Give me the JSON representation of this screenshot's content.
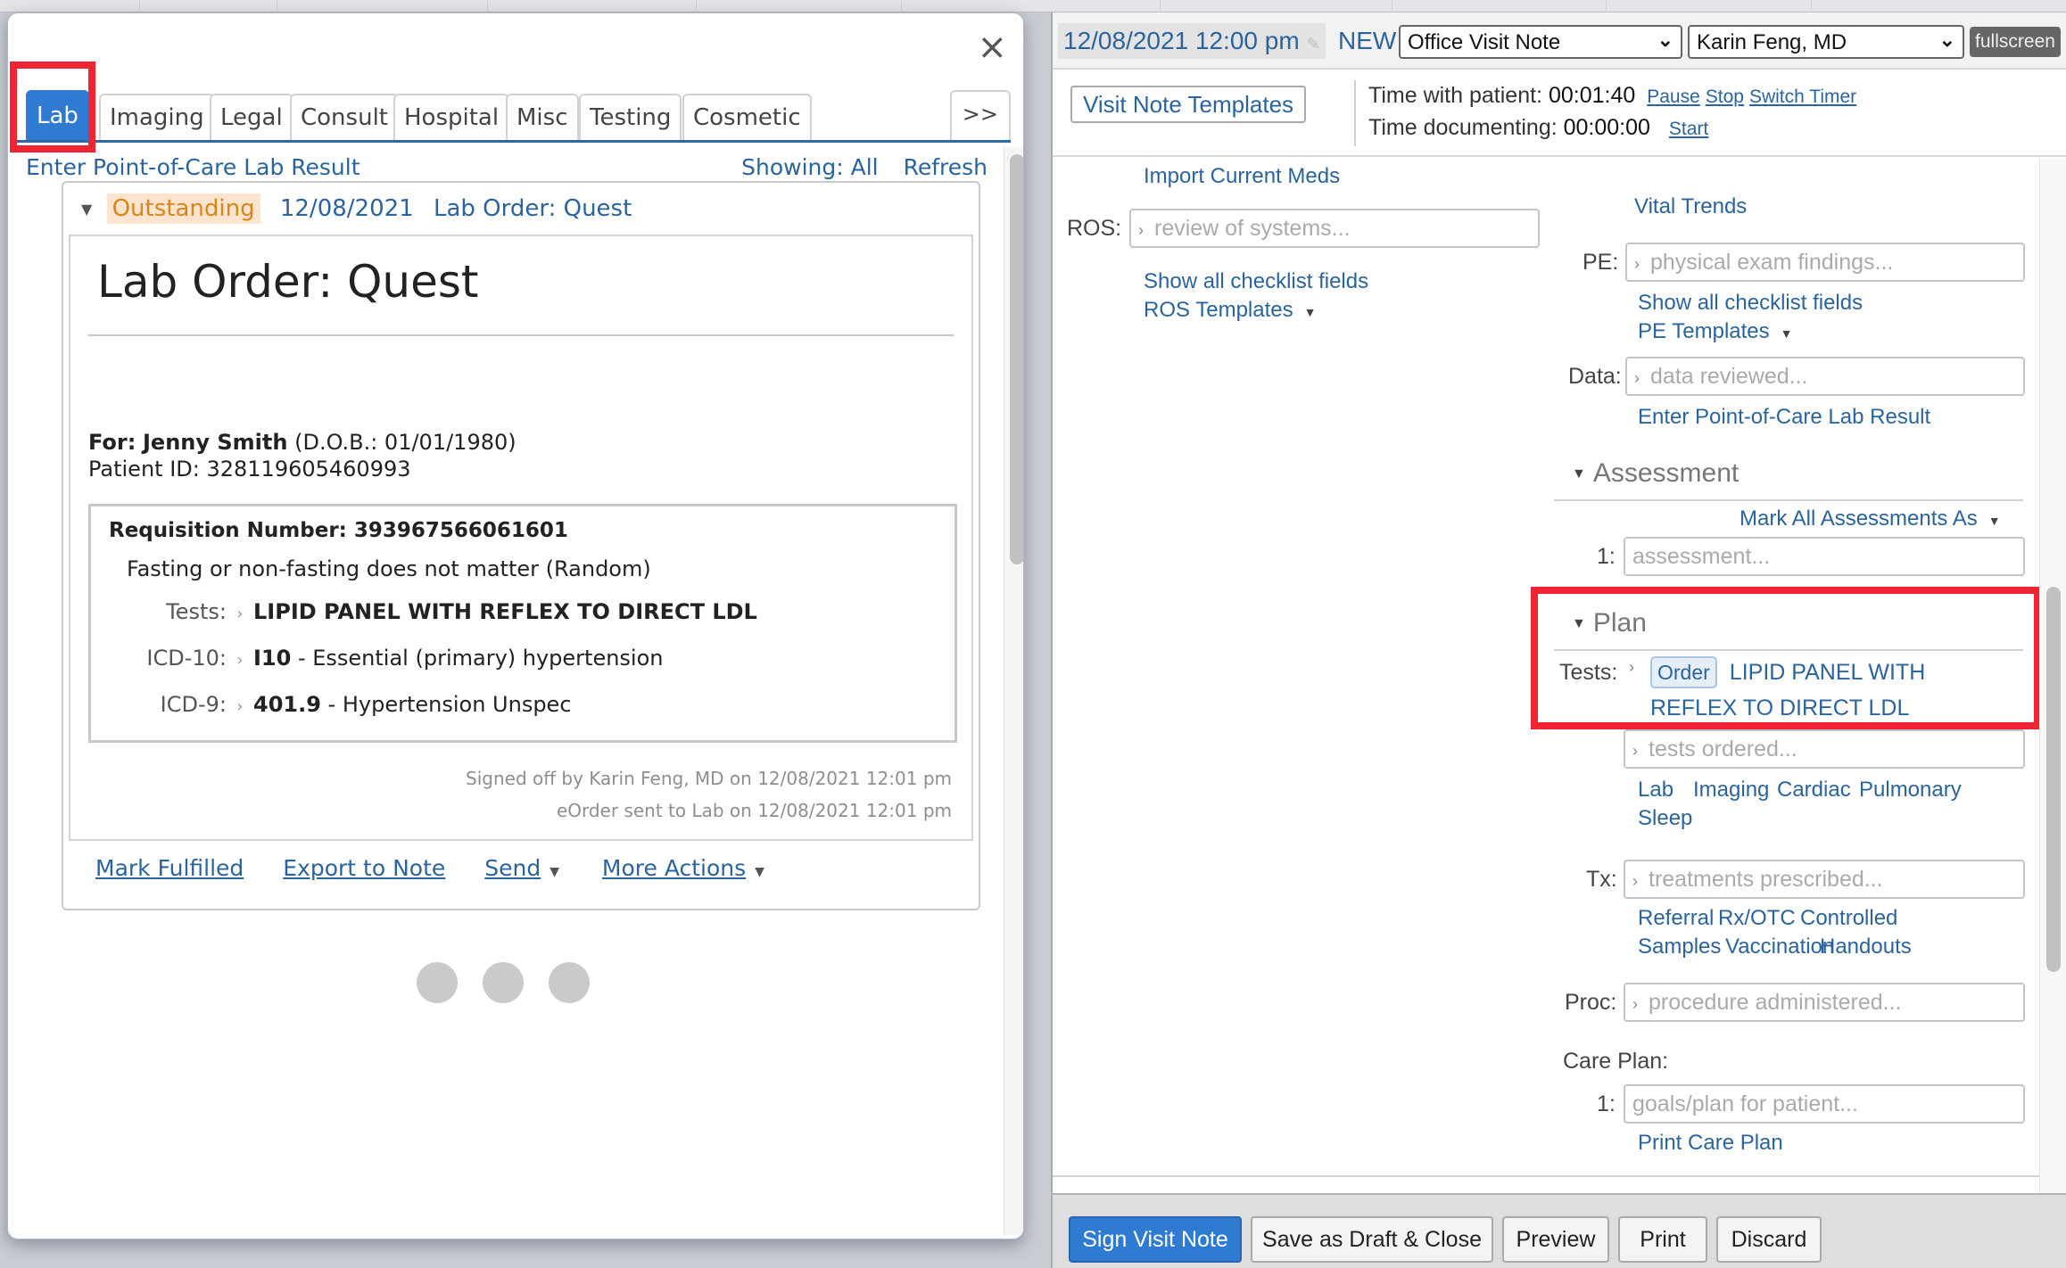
{
  "dialog": {
    "close_label": "×",
    "tabs": [
      {
        "label": "Lab",
        "active": true
      },
      {
        "label": "Imaging"
      },
      {
        "label": "Legal"
      },
      {
        "label": "Consult"
      },
      {
        "label": "Hospital"
      },
      {
        "label": "Misc"
      },
      {
        "label": "Testing"
      },
      {
        "label": "Cosmetic"
      }
    ],
    "tabs_more_label": ">>",
    "enter_poc_link": "Enter Point-of-Care Lab Result",
    "showing_label": "Showing: All",
    "refresh_label": "Refresh",
    "card": {
      "status": "Outstanding",
      "date": "12/08/2021",
      "title": "Lab Order: Quest",
      "doc_title": "Lab Order: Quest",
      "for_label": "For:",
      "patient_name": "Jenny Smith",
      "dob": "(D.O.B.: 01/01/1980)",
      "patient_id": "Patient ID: 328119605460993",
      "requisition": "Requisition Number: 393967566061601",
      "fasting": "Fasting or non-fasting does not matter (Random)",
      "rows": [
        {
          "label": "Tests:",
          "code": "LIPID PANEL WITH REFLEX TO DIRECT LDL",
          "desc": ""
        },
        {
          "label": "ICD-10:",
          "code": "I10",
          "desc": " - Essential (primary) hypertension"
        },
        {
          "label": "ICD-9:",
          "code": "401.9",
          "desc": " - Hypertension Unspec"
        }
      ],
      "signed_off": "Signed off by Karin Feng, MD on 12/08/2021 12:01 pm",
      "eorder_sent": "eOrder sent to Lab on 12/08/2021 12:01 pm",
      "actions": {
        "mark_fulfilled": "Mark Fulfilled",
        "export_to_note": "Export to Note",
        "send": "Send",
        "more_actions": "More Actions"
      }
    }
  },
  "note": {
    "datetime": "12/08/2021 12:00 pm",
    "status": "NEW",
    "note_type": "Office Visit Note",
    "provider": "Karin Feng, MD",
    "fullscreen_label": "fullscreen",
    "templates_button": "Visit Note Templates",
    "time_with_patient_label": "Time with patient:",
    "time_with_patient": "00:01:40",
    "time_documenting_label": "Time documenting:",
    "time_documenting": "00:00:00",
    "timer_links": [
      "Pause",
      "Stop",
      "Switch Timer"
    ],
    "start_label": "Start",
    "import_meds": "Import Current Meds",
    "ros": {
      "label": "ROS:",
      "placeholder": "review of systems...",
      "show_all": "Show all checklist fields",
      "templates": "ROS Templates"
    },
    "vital_trends": "Vital Trends",
    "pe": {
      "label": "PE:",
      "placeholder": "physical exam findings...",
      "show_all": "Show all checklist fields",
      "templates": "PE Templates"
    },
    "data": {
      "label": "Data:",
      "placeholder": "data reviewed...",
      "poc_link": "Enter Point-of-Care Lab Result"
    },
    "assessment": {
      "title": "Assessment",
      "mark_all": "Mark All Assessments As",
      "num": "1:",
      "placeholder": "assessment..."
    },
    "plan": {
      "title": "Plan",
      "tests_label": "Tests:",
      "order_badge": "Order",
      "test_line1": "LIPID PANEL WITH",
      "test_line2": "REFLEX TO DIRECT LDL",
      "tests_placeholder": "tests ordered...",
      "test_links_row1": [
        "Lab",
        "Imaging",
        "Cardiac",
        "Pulmonary"
      ],
      "test_links_row2": [
        "Sleep"
      ],
      "tx_label": "Tx:",
      "tx_placeholder": "treatments prescribed...",
      "tx_links_row1": [
        "Referral",
        "Rx/OTC",
        "Controlled"
      ],
      "tx_links_row2": [
        "Samples",
        "Vaccination",
        "Handouts"
      ],
      "proc_label": "Proc:",
      "proc_placeholder": "procedure administered...",
      "care_plan_label": "Care Plan:",
      "care_num": "1:",
      "care_placeholder": "goals/plan for patient...",
      "print_care_plan": "Print Care Plan"
    },
    "bottom_buttons": {
      "sign": "Sign Visit Note",
      "save_draft": "Save as Draft & Close",
      "preview": "Preview",
      "print": "Print",
      "discard": "Discard"
    }
  }
}
